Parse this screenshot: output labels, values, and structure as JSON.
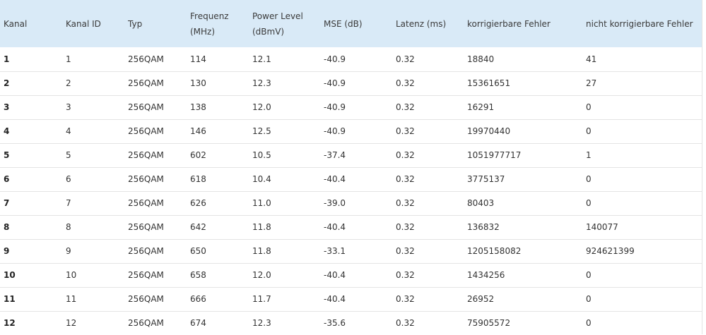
{
  "table": {
    "headers": {
      "kanal": "Kanal",
      "kanal_id": "Kanal ID",
      "typ": "Typ",
      "frequenz": "Frequenz",
      "frequenz_unit": "(MHz)",
      "power": "Power Level",
      "power_unit": "(dBmV)",
      "mse": "MSE (dB)",
      "latenz": "Latenz (ms)",
      "korr": "korrigierbare Fehler",
      "nicht_korr": "nicht korrigierbare Fehler"
    },
    "rows": [
      {
        "kanal": "1",
        "id": "1",
        "typ": "256QAM",
        "freq": "114",
        "power": "12.1",
        "mse": "-40.9",
        "latenz": "0.32",
        "korr": "18840",
        "nkorr": "41"
      },
      {
        "kanal": "2",
        "id": "2",
        "typ": "256QAM",
        "freq": "130",
        "power": "12.3",
        "mse": "-40.9",
        "latenz": "0.32",
        "korr": "15361651",
        "nkorr": "27"
      },
      {
        "kanal": "3",
        "id": "3",
        "typ": "256QAM",
        "freq": "138",
        "power": "12.0",
        "mse": "-40.9",
        "latenz": "0.32",
        "korr": "16291",
        "nkorr": "0"
      },
      {
        "kanal": "4",
        "id": "4",
        "typ": "256QAM",
        "freq": "146",
        "power": "12.5",
        "mse": "-40.9",
        "latenz": "0.32",
        "korr": "19970440",
        "nkorr": "0"
      },
      {
        "kanal": "5",
        "id": "5",
        "typ": "256QAM",
        "freq": "602",
        "power": "10.5",
        "mse": "-37.4",
        "latenz": "0.32",
        "korr": "1051977717",
        "nkorr": "1"
      },
      {
        "kanal": "6",
        "id": "6",
        "typ": "256QAM",
        "freq": "618",
        "power": "10.4",
        "mse": "-40.4",
        "latenz": "0.32",
        "korr": "3775137",
        "nkorr": "0"
      },
      {
        "kanal": "7",
        "id": "7",
        "typ": "256QAM",
        "freq": "626",
        "power": "11.0",
        "mse": "-39.0",
        "latenz": "0.32",
        "korr": "80403",
        "nkorr": "0"
      },
      {
        "kanal": "8",
        "id": "8",
        "typ": "256QAM",
        "freq": "642",
        "power": "11.8",
        "mse": "-40.4",
        "latenz": "0.32",
        "korr": "136832",
        "nkorr": "140077"
      },
      {
        "kanal": "9",
        "id": "9",
        "typ": "256QAM",
        "freq": "650",
        "power": "11.8",
        "mse": "-33.1",
        "latenz": "0.32",
        "korr": "1205158082",
        "nkorr": "924621399"
      },
      {
        "kanal": "10",
        "id": "10",
        "typ": "256QAM",
        "freq": "658",
        "power": "12.0",
        "mse": "-40.4",
        "latenz": "0.32",
        "korr": "1434256",
        "nkorr": "0"
      },
      {
        "kanal": "11",
        "id": "11",
        "typ": "256QAM",
        "freq": "666",
        "power": "11.7",
        "mse": "-40.4",
        "latenz": "0.32",
        "korr": "26952",
        "nkorr": "0"
      },
      {
        "kanal": "12",
        "id": "12",
        "typ": "256QAM",
        "freq": "674",
        "power": "12.3",
        "mse": "-35.6",
        "latenz": "0.32",
        "korr": "75905572",
        "nkorr": "0"
      }
    ]
  },
  "colors": {
    "header_bg": "#d9eaf7",
    "row_border": "#e4e4e4",
    "text": "#333333"
  }
}
